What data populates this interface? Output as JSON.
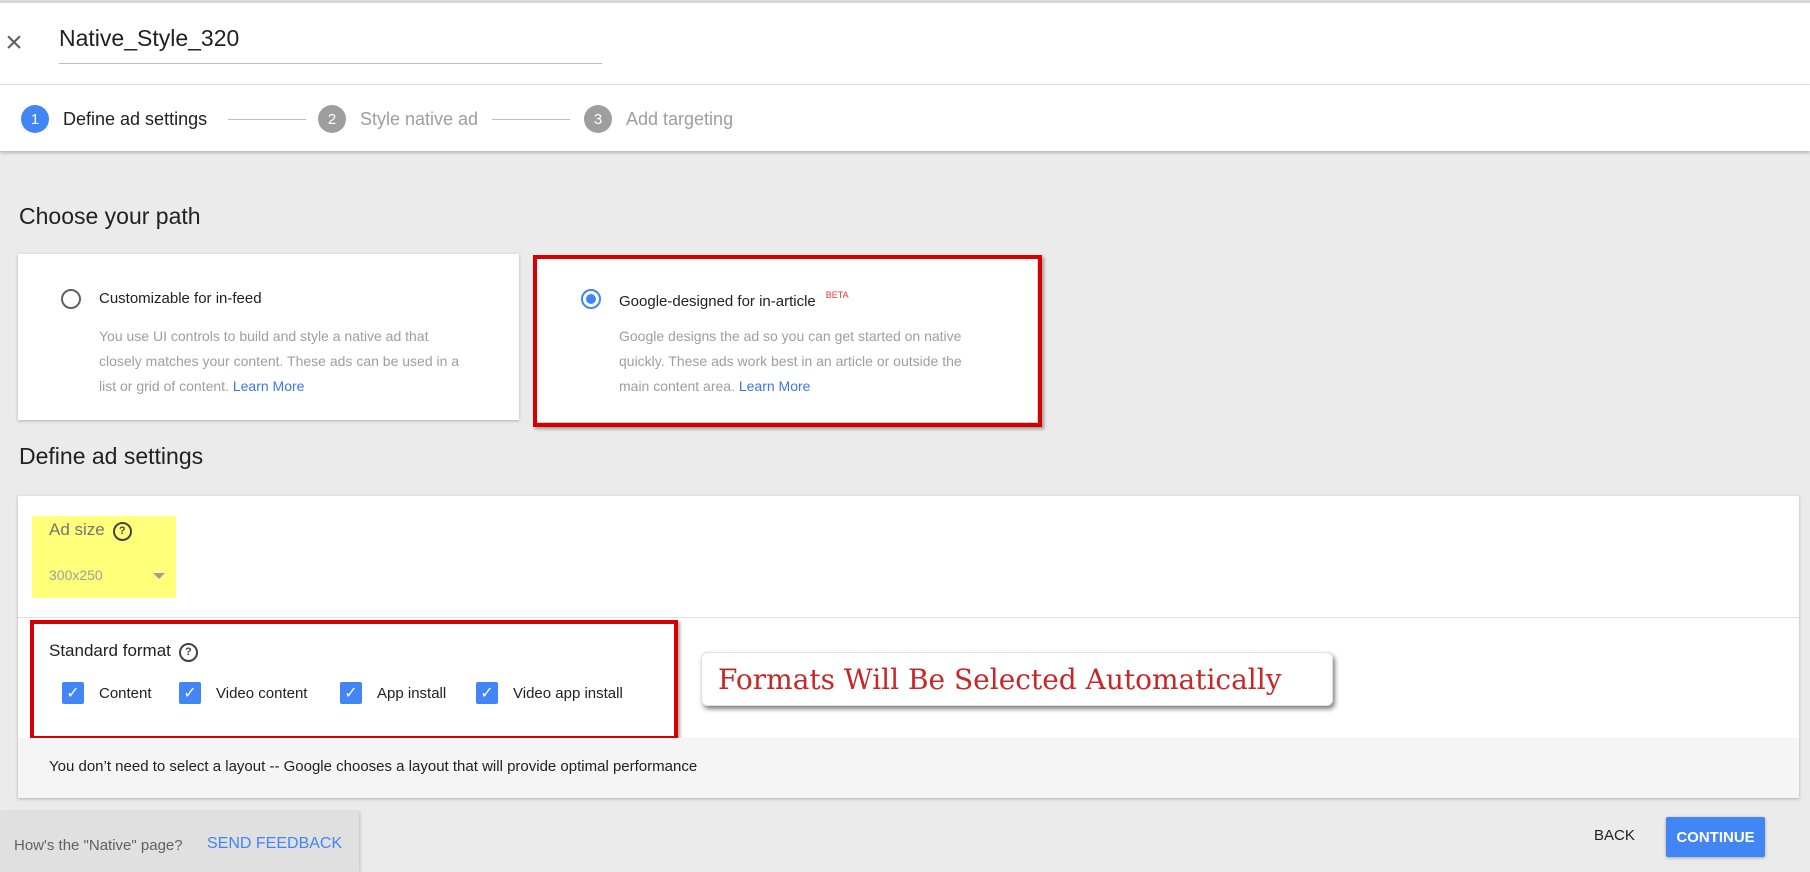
{
  "header": {
    "close_icon": "close-icon",
    "title_value": "Native_Style_320"
  },
  "steps": [
    {
      "number": "1",
      "label": "Define ad settings",
      "state": "active"
    },
    {
      "number": "2",
      "label": "Style native ad",
      "state": "inactive"
    },
    {
      "number": "3",
      "label": "Add targeting",
      "state": "inactive"
    }
  ],
  "path": {
    "heading": "Choose your path",
    "options": [
      {
        "title": "Customizable for in-feed",
        "selected": false,
        "desc_lines": [
          "You use UI controls to build and style a native ad that",
          "closely matches your content. These ads can be used in a",
          "list or grid of content."
        ],
        "link": "Learn More"
      },
      {
        "title": "Google-designed for in-article",
        "badge": "BETA",
        "selected": true,
        "desc_lines": [
          "Google designs the ad so you can get started on native",
          "quickly. These ads work best in an article or outside the",
          "main content area."
        ],
        "link": "Learn More"
      }
    ]
  },
  "settings": {
    "heading": "Define ad settings",
    "ad_size": {
      "label": "Ad size",
      "help_icon": "help-icon",
      "value": "300x250"
    },
    "standard_format": {
      "label": "Standard format",
      "help_icon": "help-icon",
      "checkboxes": [
        {
          "label": "Content",
          "checked": true
        },
        {
          "label": "Video content",
          "checked": true
        },
        {
          "label": "App install",
          "checked": true
        },
        {
          "label": "Video app install",
          "checked": true
        }
      ]
    },
    "callout": "Formats Will Be Selected Automatically",
    "layout_note": "You don’t need to select a layout -- Google chooses a layout that will provide optimal performance"
  },
  "footer": {
    "feedback_question": "How's the \"Native\" page?",
    "feedback_button": "SEND FEEDBACK",
    "back_button": "BACK",
    "continue_button": "CONTINUE"
  },
  "colors": {
    "accent": "#4285f4",
    "highlight_red": "#d50000",
    "highlight_yellow": "#ffff7a"
  }
}
